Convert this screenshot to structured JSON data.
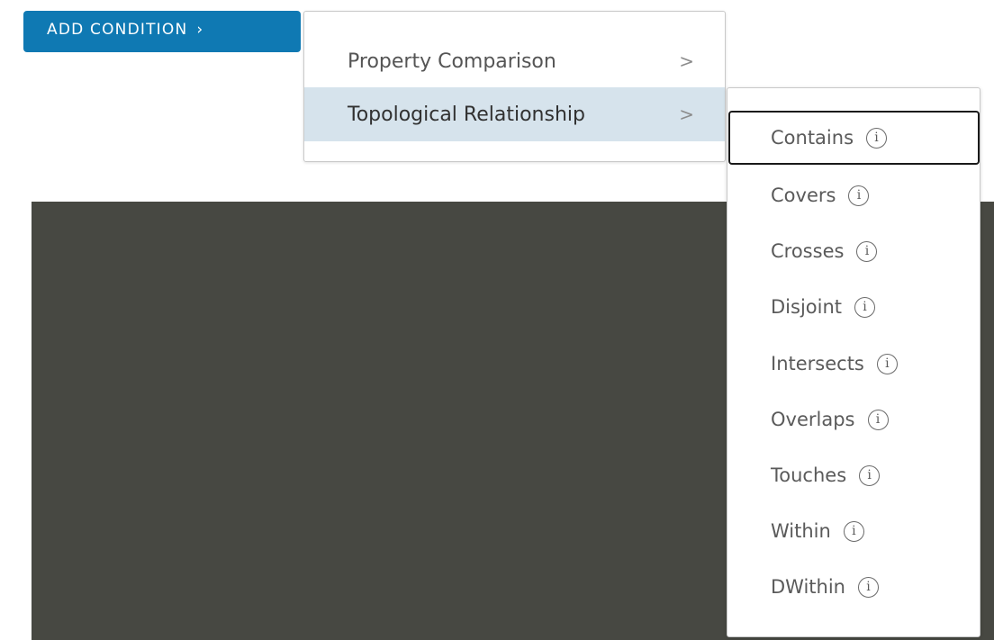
{
  "add_condition": {
    "label": "ADD CONDITION",
    "chevron": "›"
  },
  "condition_menu": {
    "items": [
      {
        "label": "Property Comparison",
        "chevron": ">"
      },
      {
        "label": "Topological Relationship",
        "chevron": ">"
      }
    ]
  },
  "topological_menu": {
    "info_glyph": "i",
    "items": [
      {
        "label": "Contains"
      },
      {
        "label": "Covers"
      },
      {
        "label": "Crosses"
      },
      {
        "label": "Disjoint"
      },
      {
        "label": "Intersects"
      },
      {
        "label": "Overlaps"
      },
      {
        "label": "Touches"
      },
      {
        "label": "Within"
      },
      {
        "label": "DWithin"
      }
    ]
  },
  "colors": {
    "button_bg": "#0f79b3",
    "active_item_bg": "#d6e3ec",
    "map_bg": "#474842"
  }
}
